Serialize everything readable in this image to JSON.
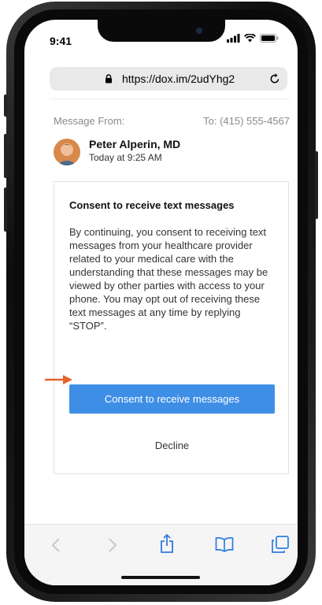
{
  "status_bar": {
    "time": "9:41"
  },
  "browser": {
    "url": "https://dox.im/2udYhg2"
  },
  "message": {
    "from_label": "Message From:",
    "to_label": "To: (415) 555-4567",
    "sender_name": "Peter Alperin, MD",
    "sent_time": "Today at 9:25 AM"
  },
  "consent_card": {
    "title": "Consent to receive text messages",
    "body": "By continuing, you consent to receiving text messages from your healthcare provider related to your medical care with the understanding that these messages may be viewed by other parties with access to your phone. You may opt out of receiving these text messages at any time by replying “STOP”.",
    "consent_button_label": "Consent to receive messages",
    "decline_button_label": "Decline"
  },
  "colors": {
    "accent": "#3f8ee6",
    "annotation_arrow": "#e8632c"
  },
  "toolbar": {
    "icons": [
      "back-icon",
      "forward-icon",
      "share-icon",
      "bookmarks-icon",
      "tabs-icon"
    ]
  }
}
